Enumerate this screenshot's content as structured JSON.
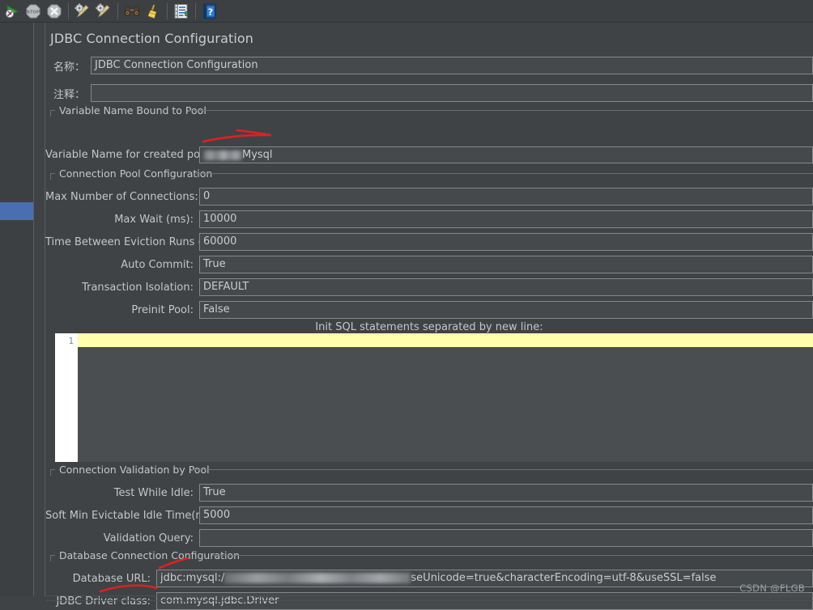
{
  "toolbar": {
    "buttons": [
      {
        "name": "start-button",
        "icon": "play-icon",
        "title": "Start"
      },
      {
        "name": "stop-button",
        "icon": "stop-icon",
        "title": "Stop"
      },
      {
        "name": "shutdown-button",
        "icon": "shutdown-icon",
        "title": "Shutdown"
      },
      {
        "name": "clear-button",
        "icon": "gear-broom-icon",
        "title": "Clear"
      },
      {
        "name": "clear-all-button",
        "icon": "gear-broom-icon",
        "title": "Clear All"
      },
      {
        "name": "search-button",
        "icon": "binoculars-icon",
        "title": "Search"
      },
      {
        "name": "reset-search-button",
        "icon": "broom-icon",
        "title": "Reset Search"
      },
      {
        "name": "function-helper-button",
        "icon": "notepad-list-icon",
        "title": "Function Helper Dialog"
      },
      {
        "name": "help-button",
        "icon": "help-book-icon",
        "title": "Help"
      }
    ]
  },
  "panel": {
    "title": "JDBC Connection Configuration",
    "name_label": "名称：",
    "name_value": "JDBC Connection Configuration",
    "comment_label": "注释：",
    "comment_value": ""
  },
  "variable_group": {
    "title": "Variable Name Bound to Pool",
    "pool_label": "Variable Name for created pool:",
    "pool_value": "Mysql"
  },
  "pool_group": {
    "title": "Connection Pool Configuration",
    "fields": [
      {
        "label": "Max Number of Connections:",
        "value": "0"
      },
      {
        "label": "Max Wait (ms):",
        "value": "10000"
      },
      {
        "label": "Time Between Eviction Runs (ms):",
        "value": "60000"
      },
      {
        "label": "Auto Commit:",
        "value": "True"
      },
      {
        "label": "Transaction Isolation:",
        "value": "DEFAULT"
      },
      {
        "label": "Preinit Pool:",
        "value": "False"
      }
    ]
  },
  "sql_editor": {
    "caption": "Init SQL statements separated by new line:",
    "line_number": "1",
    "content": ""
  },
  "validation_group": {
    "title": "Connection Validation by Pool",
    "fields": [
      {
        "label": "Test While Idle:",
        "value": "True"
      },
      {
        "label": "Soft Min Evictable Idle Time(ms):",
        "value": "5000"
      },
      {
        "label": "Validation Query:",
        "value": ""
      }
    ]
  },
  "database_group": {
    "title": "Database Connection Configuration",
    "url_label": "Database URL:",
    "url_prefix": "jdbc:mysql:/",
    "url_suffix": "seUnicode=true&characterEncoding=utf-8&useSSL=false",
    "driver_label": "JDBC Driver class:",
    "driver_value": "com.mysql.jdbc.Driver"
  },
  "watermark": "CSDN @FLGB",
  "colors": {
    "background": "#3f4345",
    "field_background": "#45494b",
    "field_border": "#84888b",
    "text": "#c7cbce",
    "selection": "#4a6fb0",
    "annotation": "#e02020",
    "current_line": "#ffffb0"
  }
}
